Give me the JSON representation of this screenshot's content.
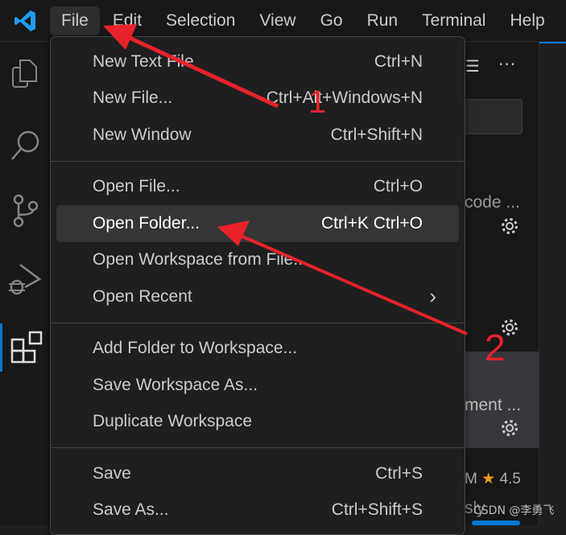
{
  "menubar": {
    "items": [
      "File",
      "Edit",
      "Selection",
      "View",
      "Go",
      "Run",
      "Terminal",
      "Help"
    ],
    "active": "File"
  },
  "file_menu": {
    "groups": [
      [
        {
          "label": "New Text File",
          "shortcut": "Ctrl+N"
        },
        {
          "label": "New File...",
          "shortcut": "Ctrl+Alt+Windows+N"
        },
        {
          "label": "New Window",
          "shortcut": "Ctrl+Shift+N"
        }
      ],
      [
        {
          "label": "Open File...",
          "shortcut": "Ctrl+O"
        },
        {
          "label": "Open Folder...",
          "shortcut": "Ctrl+K Ctrl+O"
        },
        {
          "label": "Open Workspace from File...",
          "shortcut": ""
        },
        {
          "label": "Open Recent",
          "shortcut": "›"
        }
      ],
      [
        {
          "label": "Add Folder to Workspace...",
          "shortcut": ""
        },
        {
          "label": "Save Workspace As...",
          "shortcut": ""
        },
        {
          "label": "Duplicate Workspace",
          "shortcut": ""
        }
      ],
      [
        {
          "label": "Save",
          "shortcut": "Ctrl+S"
        },
        {
          "label": "Save As...",
          "shortcut": "Ctrl+Shift+S"
        }
      ]
    ],
    "highlighted": "Open Folder..."
  },
  "panel": {
    "text1": "code ...",
    "text2": "ment ...",
    "rating_prefix": "M",
    "rating": "4.5",
    "text3": "sly"
  },
  "annotations": {
    "step1": "1",
    "step2": "2",
    "color": "#e8222a"
  },
  "watermark": "CSDN @李勇飞",
  "colors": {
    "accent": "#0078d4",
    "star": "#f39c12"
  }
}
